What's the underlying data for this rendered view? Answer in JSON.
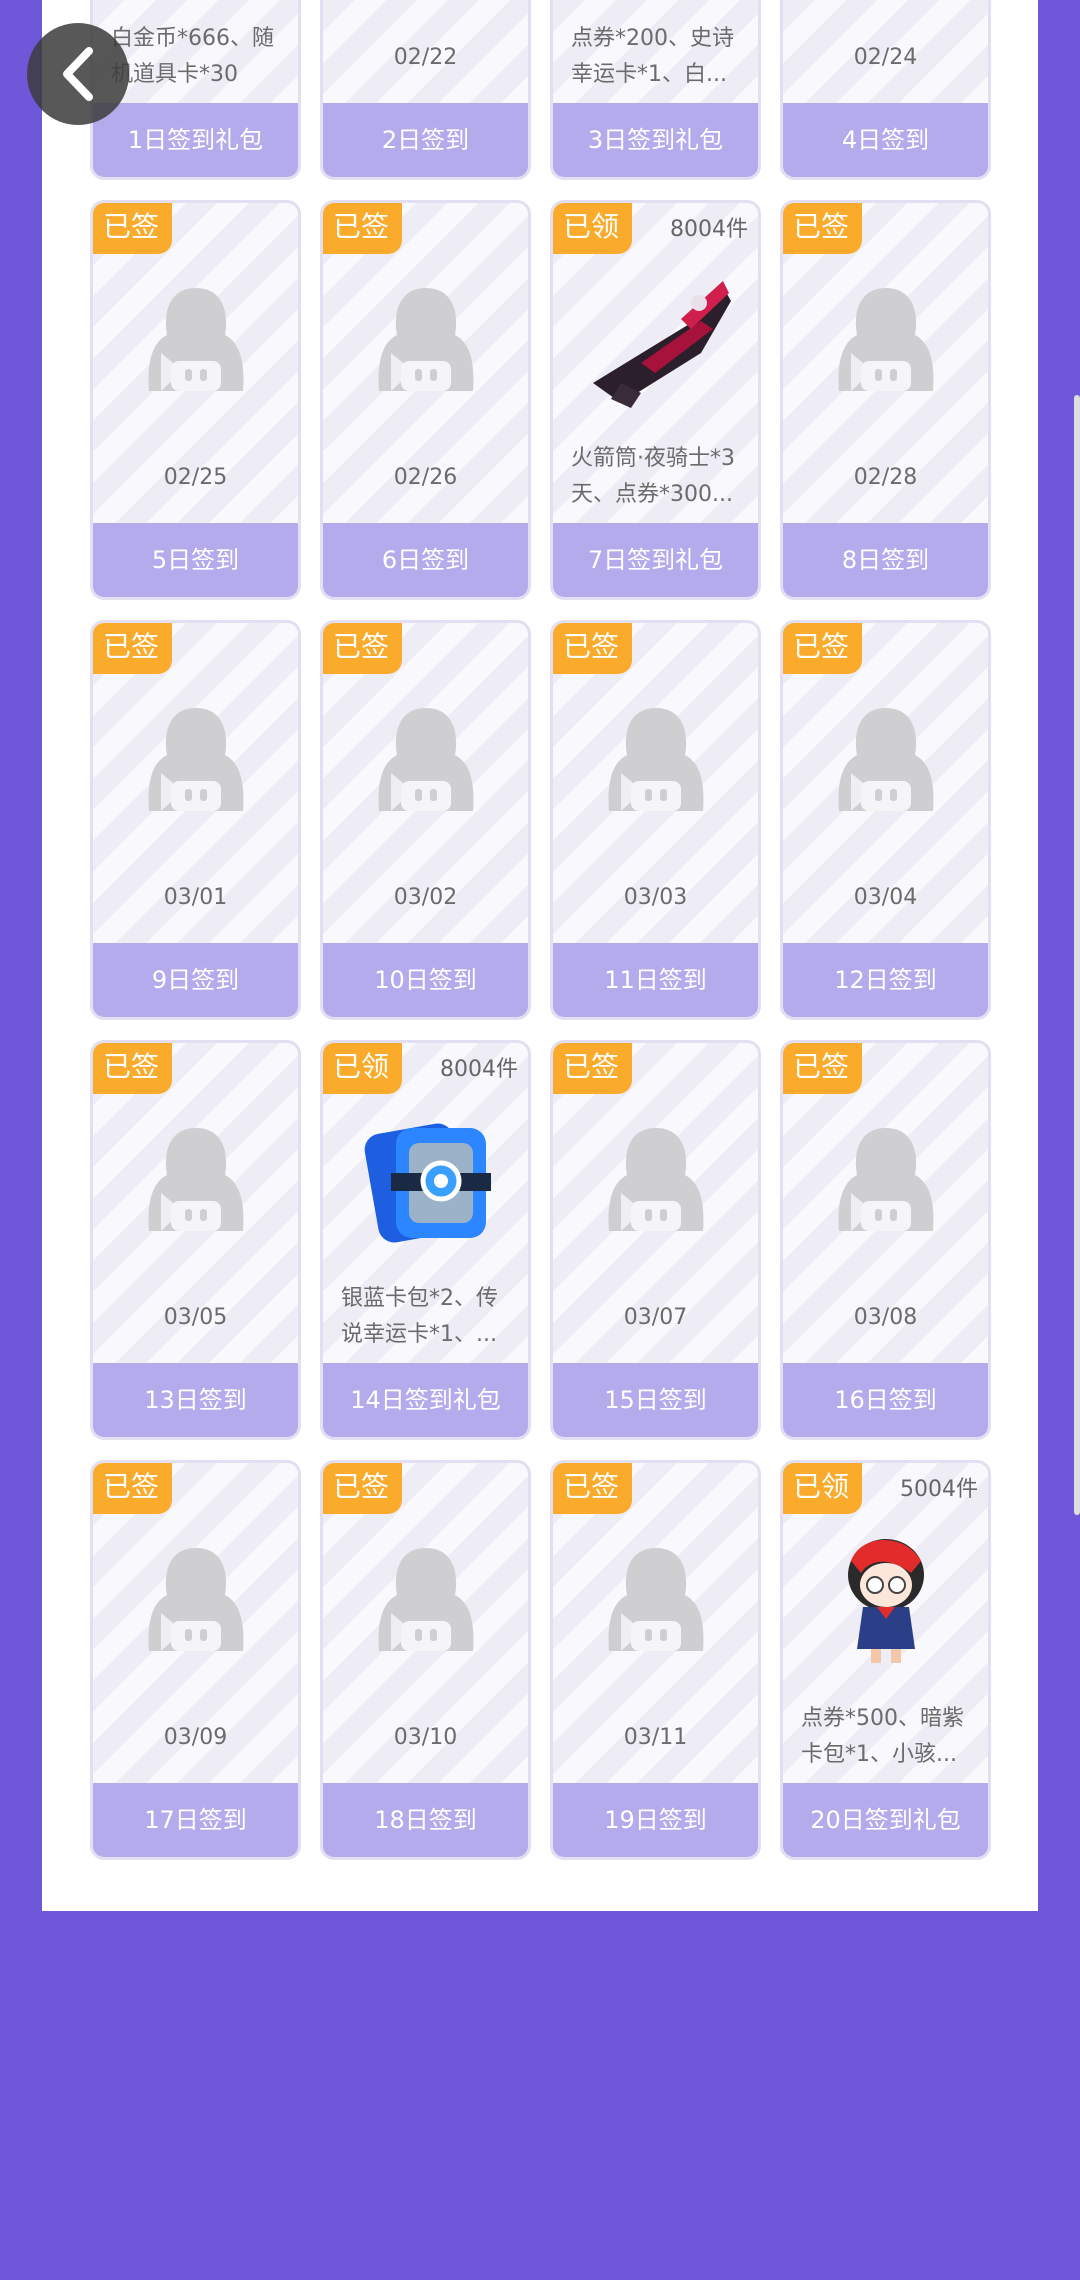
{
  "colors": {
    "page_bg": "#6f57d9",
    "badge": "#fbab2b",
    "button_bar": "#b4abec",
    "card_border": "#e3dff2"
  },
  "icons": {
    "back": "chevron-left-icon",
    "placeholder": "mascot-placeholder-icon"
  },
  "cards": [
    {
      "badge": "",
      "count": "",
      "date": "",
      "desc": "白金币*666、随机道具卡*30",
      "label": "1日签到礼包",
      "image": "blue-card-pack"
    },
    {
      "badge": "",
      "count": "",
      "date": "02/22",
      "desc": "",
      "label": "2日签到",
      "image": "placeholder"
    },
    {
      "badge": "",
      "count": "",
      "date": "",
      "desc": "点券*200、史诗幸运卡*1、白...",
      "label": "3日签到礼包",
      "image": ""
    },
    {
      "badge": "",
      "count": "",
      "date": "02/24",
      "desc": "",
      "label": "4日签到",
      "image": "placeholder"
    },
    {
      "badge": "已签",
      "count": "",
      "date": "02/25",
      "desc": "",
      "label": "5日签到",
      "image": "placeholder"
    },
    {
      "badge": "已签",
      "count": "",
      "date": "02/26",
      "desc": "",
      "label": "6日签到",
      "image": "placeholder"
    },
    {
      "badge": "已领",
      "count": "8004件",
      "date": "",
      "desc": "火箭筒·夜骑士*3天、点券*300...",
      "label": "7日签到礼包",
      "image": "rocket-launcher"
    },
    {
      "badge": "已签",
      "count": "",
      "date": "02/28",
      "desc": "",
      "label": "8日签到",
      "image": "placeholder"
    },
    {
      "badge": "已签",
      "count": "",
      "date": "03/01",
      "desc": "",
      "label": "9日签到",
      "image": "placeholder"
    },
    {
      "badge": "已签",
      "count": "",
      "date": "03/02",
      "desc": "",
      "label": "10日签到",
      "image": "placeholder"
    },
    {
      "badge": "已签",
      "count": "",
      "date": "03/03",
      "desc": "",
      "label": "11日签到",
      "image": "placeholder"
    },
    {
      "badge": "已签",
      "count": "",
      "date": "03/04",
      "desc": "",
      "label": "12日签到",
      "image": "placeholder"
    },
    {
      "badge": "已签",
      "count": "",
      "date": "03/05",
      "desc": "",
      "label": "13日签到",
      "image": "placeholder"
    },
    {
      "badge": "已领",
      "count": "8004件",
      "date": "",
      "desc": "银蓝卡包*2、传说幸运卡*1、...",
      "label": "14日签到礼包",
      "image": "blue-card-pack"
    },
    {
      "badge": "已签",
      "count": "",
      "date": "03/07",
      "desc": "",
      "label": "15日签到",
      "image": "placeholder"
    },
    {
      "badge": "已签",
      "count": "",
      "date": "03/08",
      "desc": "",
      "label": "16日签到",
      "image": "placeholder"
    },
    {
      "badge": "已签",
      "count": "",
      "date": "03/09",
      "desc": "",
      "label": "17日签到",
      "image": "placeholder"
    },
    {
      "badge": "已签",
      "count": "",
      "date": "03/10",
      "desc": "",
      "label": "18日签到",
      "image": "placeholder"
    },
    {
      "badge": "已签",
      "count": "",
      "date": "03/11",
      "desc": "",
      "label": "19日签到",
      "image": "placeholder"
    },
    {
      "badge": "已领",
      "count": "5004件",
      "date": "",
      "desc": "点券*500、暗紫卡包*1、小骇...",
      "label": "20日签到礼包",
      "image": "character-girl"
    }
  ]
}
